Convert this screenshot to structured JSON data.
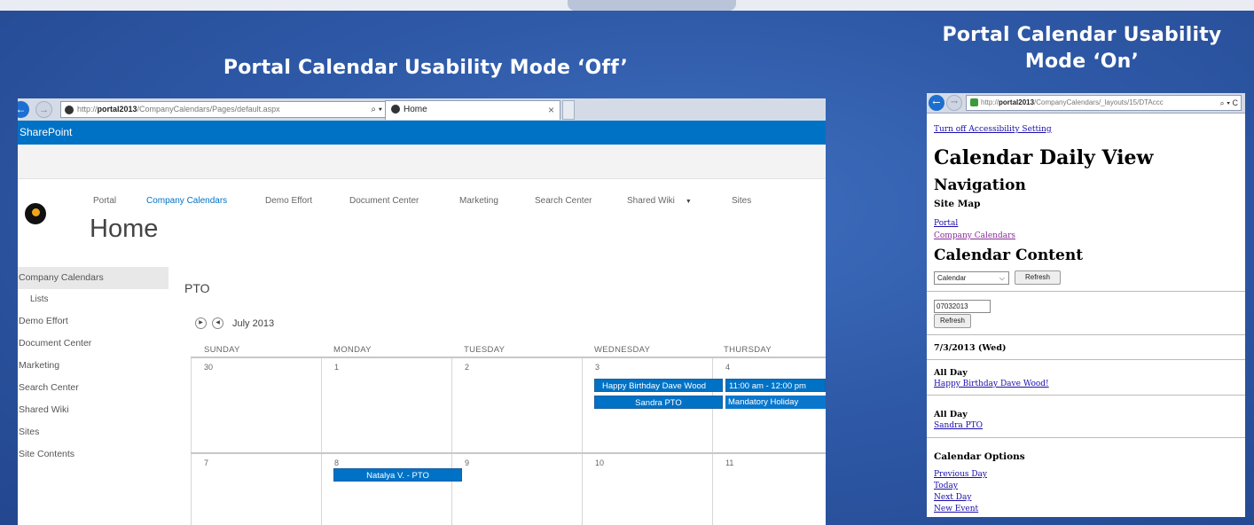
{
  "headings": {
    "off": "Portal Calendar Usability Mode ‘Off’",
    "on_line1": "Portal Calendar Usability",
    "on_line2": "Mode ‘On’"
  },
  "left_browser": {
    "address_prefix": "http://",
    "address_host": "portal2013",
    "address_path": "/CompanyCalendars/Pages/default.aspx",
    "address_tools": "⌕ ▾ C",
    "tab_title": "Home",
    "tab_close": "×",
    "suite_bar_title": "SharePoint"
  },
  "top_nav": [
    {
      "label": "Portal"
    },
    {
      "label": "Company Calendars"
    },
    {
      "label": "Demo Effort"
    },
    {
      "label": "Document Center"
    },
    {
      "label": "Marketing"
    },
    {
      "label": "Search Center"
    },
    {
      "label": "Shared Wiki"
    },
    {
      "label": "Sites"
    }
  ],
  "page_title": "Home",
  "left_nav": [
    {
      "label": "Company Calendars"
    },
    {
      "label": "Lists"
    },
    {
      "label": "Demo Effort"
    },
    {
      "label": "Document Center"
    },
    {
      "label": "Marketing"
    },
    {
      "label": "Search Center"
    },
    {
      "label": "Shared Wiki"
    },
    {
      "label": "Sites"
    },
    {
      "label": "Site Contents"
    }
  ],
  "calendar": {
    "list_title": "PTO",
    "month": "July 2013",
    "day_names": [
      "SUNDAY",
      "MONDAY",
      "TUESDAY",
      "WEDNESDAY",
      "THURSDAY"
    ],
    "week1": [
      "30",
      "1",
      "2",
      "3",
      "4"
    ],
    "week2": [
      "7",
      "8",
      "9",
      "10",
      "11"
    ],
    "events": {
      "birthday": "Happy Birthday Dave Wood",
      "sandra": "Sandra PTO",
      "holiday_time": "11:00 am - 12:00 pm",
      "holiday": "Mandatory Holiday",
      "natalya": "Natalya V. - PTO"
    }
  },
  "right_browser": {
    "address_prefix": "http://",
    "address_host": "portal2013",
    "address_path": "/CompanyCalendars/_layouts/15/DTAccc",
    "address_tools": "⌕ ▾ C"
  },
  "accessible_view": {
    "turn_off_link": "Turn off Accessibility Setting",
    "title": "Calendar Daily View",
    "navigation_heading": "Navigation",
    "site_map_heading": "Site Map",
    "nav_links": [
      "Portal",
      "Company Calendars"
    ],
    "content_heading": "Calendar Content",
    "view_select_value": "Calendar",
    "refresh_label": "Refresh",
    "date_input_value": "07032013",
    "date_heading": "7/3/2013 (Wed)",
    "all_day_label": "All Day",
    "event_1": "Happy Birthday Dave Wood!",
    "event_2": "Sandra PTO",
    "options_heading": "Calendar Options",
    "options_links": [
      "Previous Day",
      "Today",
      "Next Day",
      "New Event"
    ]
  }
}
